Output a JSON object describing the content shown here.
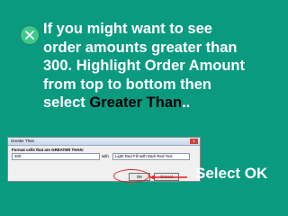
{
  "instruction": {
    "line1": "If you might want to see",
    "line2": "order amounts greater than",
    "line3": "300. Highlight Order Amount",
    "line4": "from top to bottom then",
    "line5_prefix": "select ",
    "line5_highlight": "Greater Than",
    "line5_suffix": "..",
    "highlight_color": "#000000"
  },
  "badge_icon": "x-icon",
  "dialog": {
    "title": "Greater Than",
    "close_label": "x",
    "prompt_label": "Format cells that are GREATER THAN:",
    "value": "300",
    "with_label": "with",
    "format_value": "Light Red Fill with Dark Red Text",
    "ok_label": "OK",
    "cancel_label": "Cancel"
  },
  "callout": {
    "label": "Select OK",
    "ring_color": "#e02020"
  },
  "colors": {
    "background": "#0a9a80",
    "badge": "#3fc98c",
    "text": "#ffffff"
  }
}
